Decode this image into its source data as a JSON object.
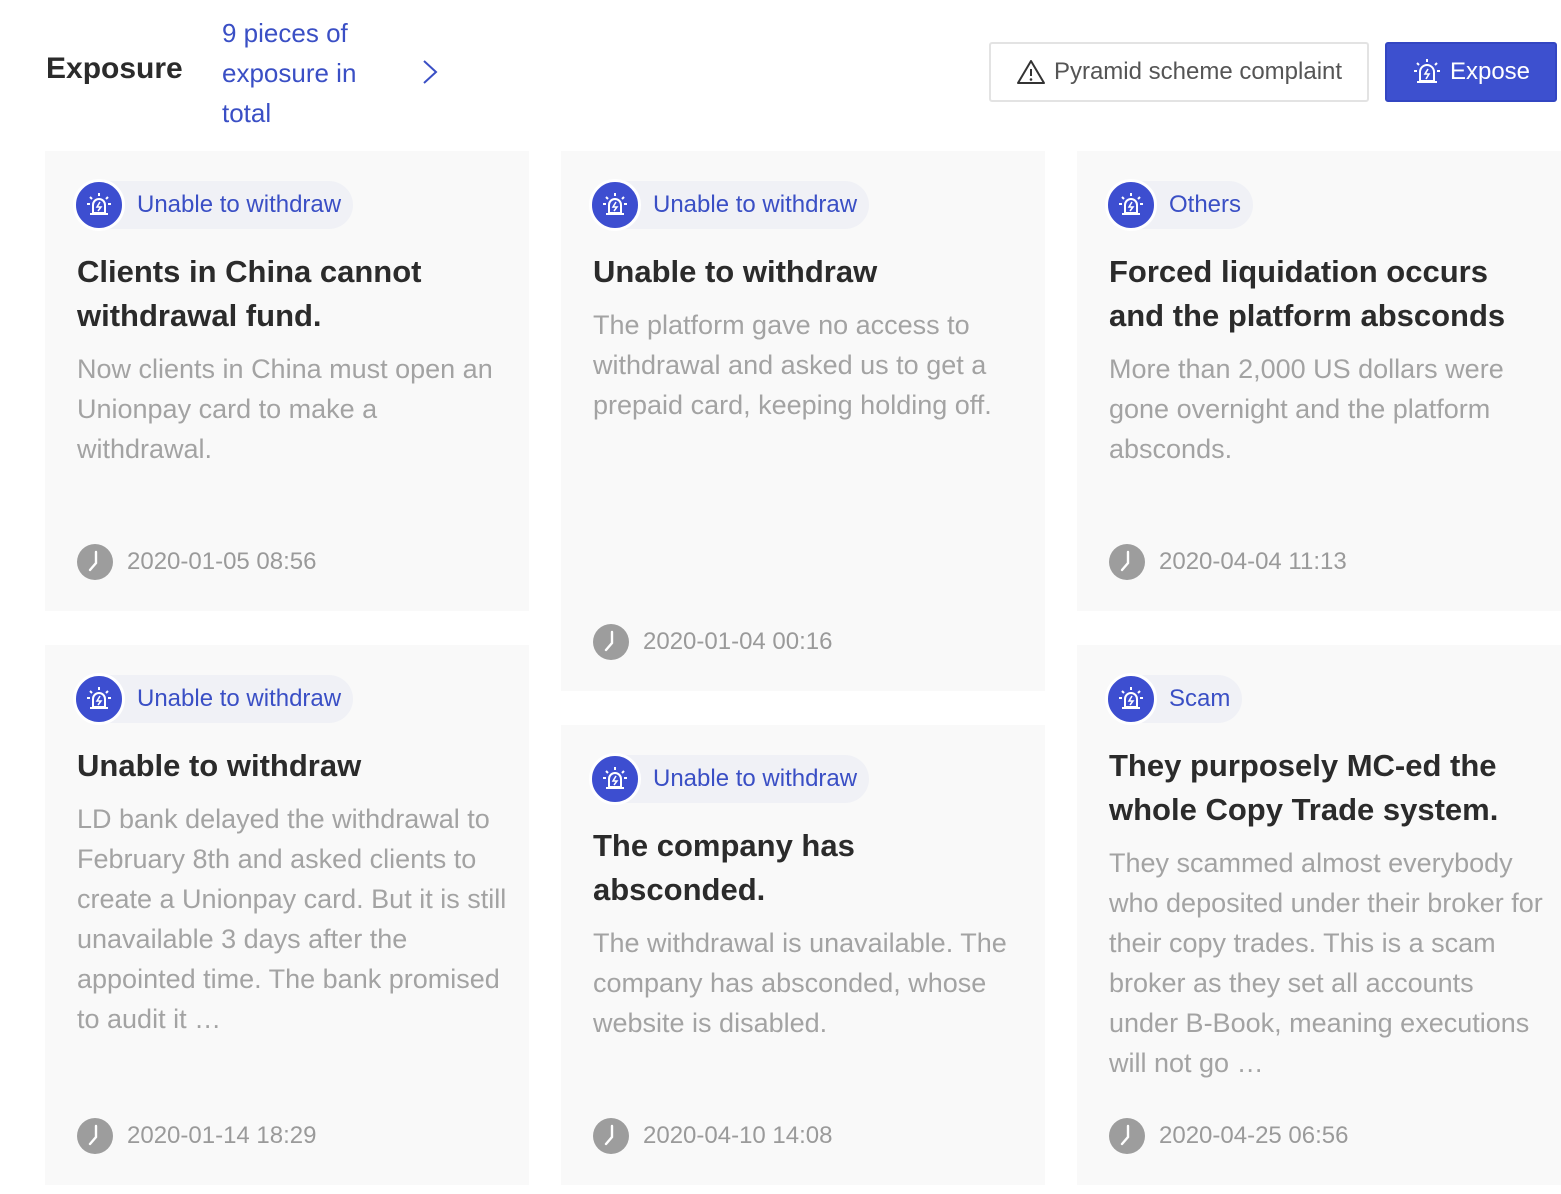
{
  "header": {
    "title": "Exposure",
    "count_text": "9 pieces of exposure in total",
    "complaint_button": "Pyramid scheme complaint",
    "expose_button": "Expose"
  },
  "colors": {
    "accent": "#3d50cf",
    "link": "#3a4fc5",
    "card_bg": "#f9f9f9",
    "muted_text": "#a3a3a3"
  },
  "cards": [
    {
      "tag": "Unable to withdraw",
      "title": "Clients in China cannot withdrawal fund.",
      "description": "Now clients in China must open an Unionpay card to make a withdrawal.",
      "time": "2020-01-05 08:56"
    },
    {
      "tag": "Unable to withdraw",
      "title": "Unable to withdraw",
      "description": "The platform gave no access to withdrawal and asked us to get a prepaid card, keeping holding off.",
      "time": "2020-01-04 00:16"
    },
    {
      "tag": "Others",
      "title": "Forced liquidation occurs and the platform absconds",
      "description": "More than 2,000 US dollars were gone overnight and the platform absconds.",
      "time": "2020-04-04 11:13"
    },
    {
      "tag": "Unable to withdraw",
      "title": "Unable to withdraw",
      "description": "LD bank delayed the withdrawal to February 8th and asked clients to create a Unionpay card. But it is still unavailable 3 days after the appointed time. The bank promised to audit it …",
      "time": "2020-01-14 18:29"
    },
    {
      "tag": "Unable to withdraw",
      "title": "The company has absconded.",
      "description": "The withdrawal is unavailable. The company has absconded, whose website is disabled.",
      "time": "2020-04-10 14:08"
    },
    {
      "tag": "Scam",
      "title": "They purposely MC-ed the whole Copy Trade system.",
      "description": "They scammed almost everybody who deposited under their broker for their copy trades. This is a scam broker as they set all accounts under B-Book, meaning executions will not go …",
      "time": "2020-04-25 06:56"
    }
  ]
}
